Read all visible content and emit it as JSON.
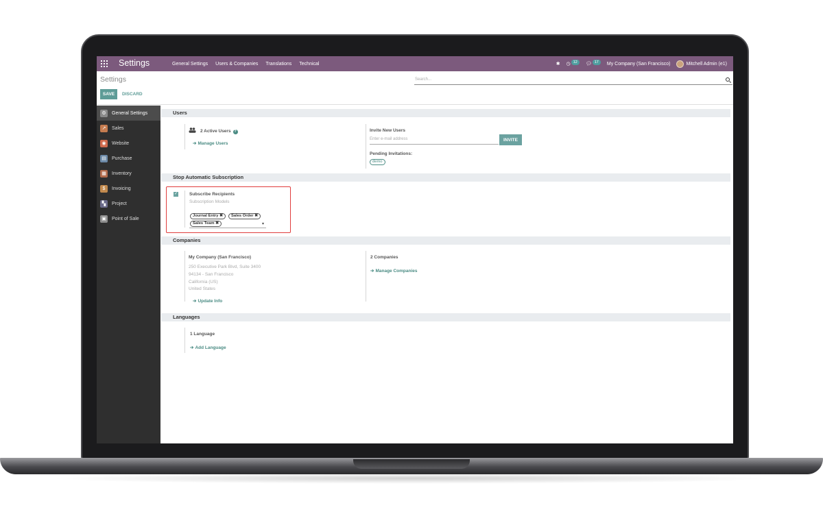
{
  "topbar": {
    "brand": "Settings",
    "menu": [
      "General Settings",
      "Users & Companies",
      "Translations",
      "Technical"
    ],
    "activity_count": "12",
    "messages_count": "17",
    "company": "My Company (San Francisco)",
    "user": "Mitchell Admin (e1)"
  },
  "control_panel": {
    "title": "Settings",
    "save_label": "SAVE",
    "discard_label": "DISCARD",
    "search_placeholder": "Search..."
  },
  "sidebar": {
    "items": [
      {
        "label": "General Settings",
        "icon": "gear-icon",
        "color": "#8a8a8a",
        "active": true
      },
      {
        "label": "Sales",
        "icon": "sales-icon",
        "color": "#c57c50"
      },
      {
        "label": "Website",
        "icon": "globe-icon",
        "color": "#d06a4d"
      },
      {
        "label": "Purchase",
        "icon": "purchase-icon",
        "color": "#6d8aa8"
      },
      {
        "label": "Inventory",
        "icon": "inventory-icon",
        "color": "#b26b4b"
      },
      {
        "label": "Invoicing",
        "icon": "invoice-icon",
        "color": "#c28a4e"
      },
      {
        "label": "Project",
        "icon": "project-icon",
        "color": "#6b6b8a"
      },
      {
        "label": "Point of Sale",
        "icon": "pos-icon",
        "color": "#8e8e8e"
      }
    ]
  },
  "users": {
    "heading": "Users",
    "active_users": "2 Active Users",
    "manage_users": "Manage Users",
    "invite_title": "Invite New Users",
    "invite_placeholder": "Enter e-mail address",
    "invite_button": "INVITE",
    "pending_title": "Pending Invitations:",
    "pending_tag": "demo"
  },
  "subscription": {
    "heading": "Stop Automatic Subscription",
    "label": "Subscribe Recipients",
    "sublabel": "Subscription Models",
    "tags": [
      "Journal Entry",
      "Sales Order",
      "Sales Team"
    ]
  },
  "companies": {
    "heading": "Companies",
    "company_name": "My Company (San Francisco)",
    "address": [
      "250 Executive Park Blvd, Suite 3400",
      "94134 - San Francisco",
      "California (US)",
      "United States"
    ],
    "update_info": "Update Info",
    "count": "2 Companies",
    "manage": "Manage Companies"
  },
  "languages": {
    "heading": "Languages",
    "count": "1 Language",
    "add": "Add Language"
  },
  "colors": {
    "topbar": "#7c5a7d",
    "accent": "#5e9c97",
    "highlight": "#e03c3c"
  }
}
